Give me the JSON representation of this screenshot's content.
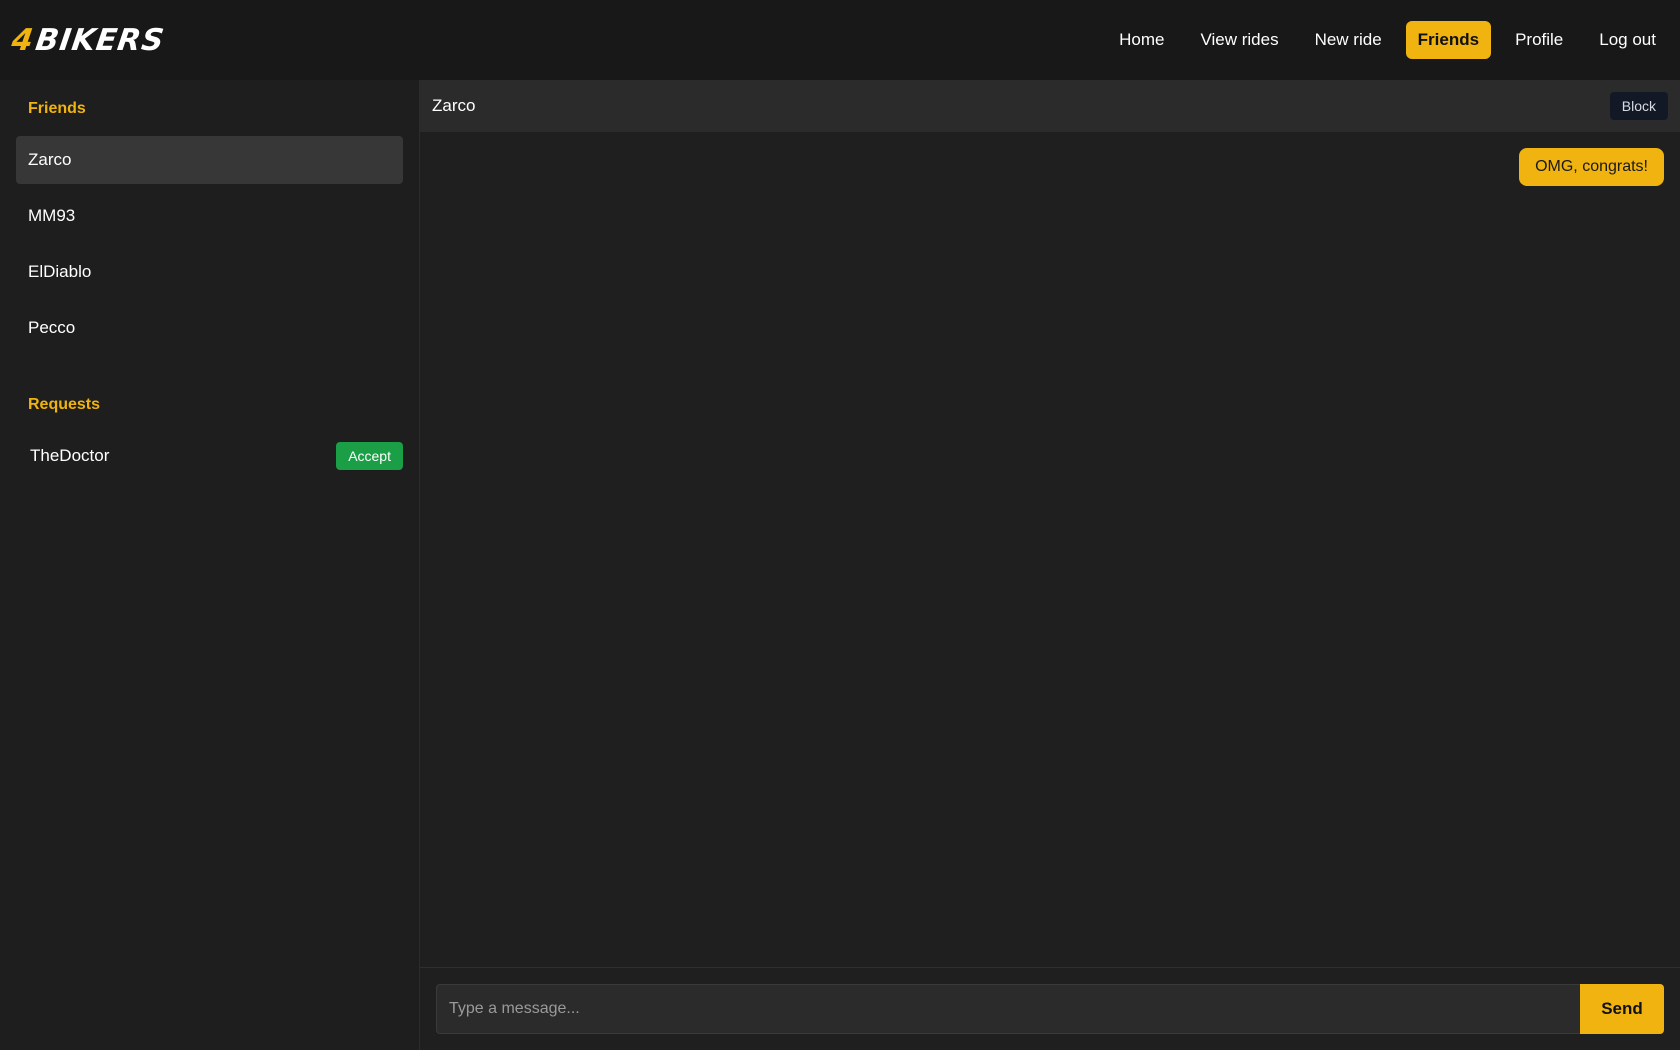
{
  "app": {
    "logo": {
      "number": "4",
      "word": "BIKERS"
    },
    "accent_color": "#f0b30f"
  },
  "nav": {
    "items": [
      {
        "label": "Home",
        "active": false
      },
      {
        "label": "View rides",
        "active": false
      },
      {
        "label": "New ride",
        "active": false
      },
      {
        "label": "Friends",
        "active": true
      },
      {
        "label": "Profile",
        "active": false
      },
      {
        "label": "Log out",
        "active": false
      }
    ]
  },
  "sidebar": {
    "friends_title": "Friends",
    "friends": [
      {
        "name": "Zarco",
        "selected": true
      },
      {
        "name": "MM93",
        "selected": false
      },
      {
        "name": "ElDiablo",
        "selected": false
      },
      {
        "name": "Pecco",
        "selected": false
      }
    ],
    "requests_title": "Requests",
    "requests": [
      {
        "name": "TheDoctor",
        "action_label": "Accept"
      }
    ]
  },
  "chat": {
    "title": "Zarco",
    "block_label": "Block",
    "messages": [
      {
        "text": "OMG, congrats!",
        "from_me": true
      }
    ],
    "input_placeholder": "Type a message...",
    "send_label": "Send"
  }
}
